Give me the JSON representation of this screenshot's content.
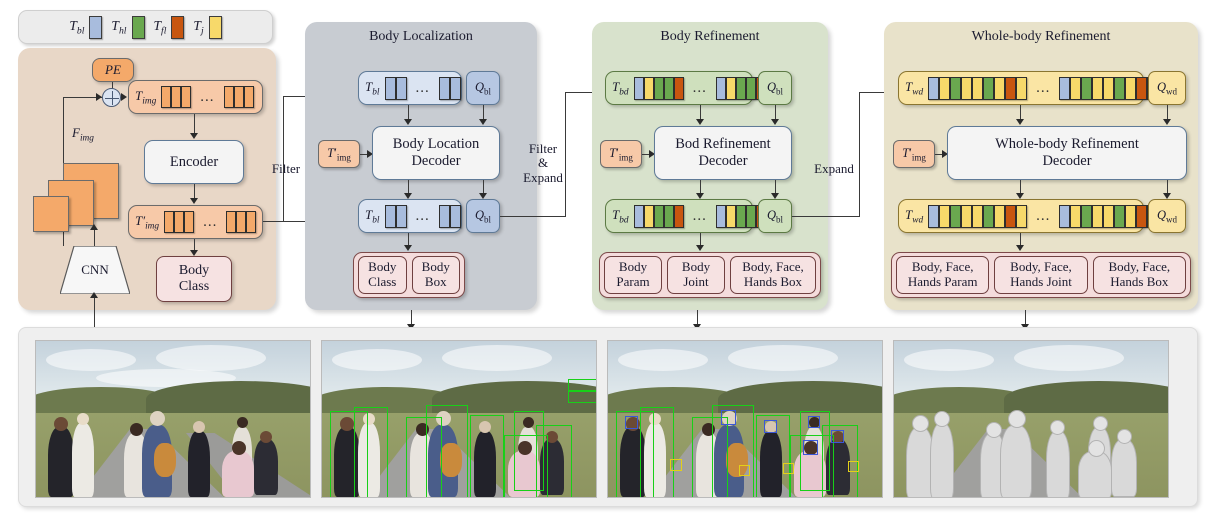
{
  "legend": {
    "items": [
      {
        "label": "T_bl",
        "name": "body-localization-token",
        "color": "#a8bcdd"
      },
      {
        "label": "T_hl",
        "name": "hand-localization-token",
        "color": "#6aa84f"
      },
      {
        "label": "T_fl",
        "name": "face-localization-token",
        "color": "#c8560f"
      },
      {
        "label": "T_j",
        "name": "joint-token",
        "color": "#f7d96a"
      }
    ]
  },
  "panels": {
    "backbone": {
      "title": "",
      "pe_label": "PE",
      "plus_label": "+",
      "fimg_label": "F_img",
      "timg_label": "T_img",
      "timg_prime_label": "T'_img",
      "encoder_label": "Encoder",
      "cnn_label": "CNN",
      "output_label": "Body\nClass",
      "output_line1": "Body",
      "output_line2": "Class",
      "bg_color": "#e8d7c7"
    },
    "body_localization": {
      "title": "Body Localization",
      "bg_color": "#c8ccd2",
      "seq_top_label": "T_bl",
      "seq_bottom_label": "T_bl",
      "query_top_label": "Q_bl",
      "query_bottom_label": "Q_bl",
      "timg_label": "T'_img",
      "decoder_line1": "Body Location",
      "decoder_line2": "Decoder",
      "outputs": [
        {
          "line1": "Body",
          "line2": "Class"
        },
        {
          "line1": "Body",
          "line2": "Box"
        }
      ],
      "token_group": [
        "#a8bcdd",
        "#a8bcdd"
      ],
      "seq_color": "#dbe4f2",
      "query_color": "#b6c7e2"
    },
    "body_refinement": {
      "title": "Body Refinement",
      "bg_color": "#d8e2cc",
      "seq_top_label": "T_bd",
      "seq_bottom_label": "T_bd",
      "query_top_label": "Q_bl",
      "query_bottom_label": "Q_bl",
      "timg_label": "T'_img",
      "decoder_line1": "Bod Refinement",
      "decoder_line2": "Decoder",
      "outputs": [
        {
          "line1": "Body",
          "line2": "Param"
        },
        {
          "line1": "Body",
          "line2": "Joint"
        },
        {
          "line1": "Body, Face,",
          "line2": "Hands Box"
        }
      ],
      "token_group": [
        "#a8bcdd",
        "#f7d96a",
        "#6aa84f",
        "#6aa84f",
        "#c8560f"
      ],
      "seq_color": "#cfe0bd",
      "query_color": "#cfe0bd"
    },
    "wholebody_refinement": {
      "title": "Whole-body Refinement",
      "bg_color": "#e8e2ca",
      "seq_top_label": "T_wd",
      "seq_bottom_label": "T_wd",
      "query_top_label": "Q_wd",
      "query_bottom_label": "Q_wd",
      "timg_label": "T'_img",
      "decoder_line1": "Whole-body Refinement",
      "decoder_line2": "Decoder",
      "outputs": [
        {
          "line1": "Body, Face,",
          "line2": "Hands Param"
        },
        {
          "line1": "Body, Face,",
          "line2": "Hands Joint"
        },
        {
          "line1": "Body, Face,",
          "line2": "Hands Box"
        }
      ],
      "token_group": [
        "#a8bcdd",
        "#f7d96a",
        "#6aa84f",
        "#f7d96a",
        "#f7d96a",
        "#6aa84f",
        "#f7d96a",
        "#c8560f",
        "#f7d96a"
      ],
      "seq_color": "#fae5a4",
      "query_color": "#fae5a4"
    }
  },
  "connectors": {
    "filter": "Filter",
    "filter_expand_l1": "Filter",
    "filter_expand_l2": "&",
    "filter_expand_l3": "Expand",
    "expand": "Expand"
  },
  "ellipsis": "...",
  "photos": [
    {
      "name": "input-image",
      "caption": ""
    },
    {
      "name": "body-boxes-image",
      "caption": ""
    },
    {
      "name": "refined-boxes-image",
      "caption": ""
    },
    {
      "name": "mesh-output-image",
      "caption": ""
    }
  ]
}
